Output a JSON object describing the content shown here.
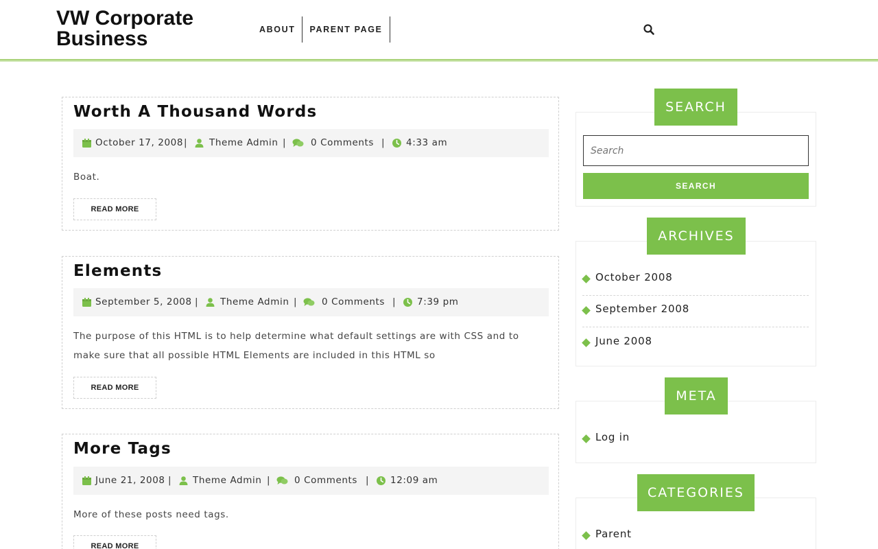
{
  "site": {
    "title": "VW Corporate Business"
  },
  "nav": {
    "items": [
      {
        "label": "ABOUT"
      },
      {
        "label": "PARENT PAGE"
      }
    ]
  },
  "icons": {
    "search": "search-icon",
    "calendar": "calendar-icon",
    "user": "user-icon",
    "comments": "comments-icon",
    "clock": "clock-icon",
    "bullet": "diamond-bullet-icon"
  },
  "colors": {
    "accent": "#7cc04b"
  },
  "posts": [
    {
      "title": "Worth A Thousand Words",
      "date": "October 17, 2008",
      "author": "Theme Admin",
      "comments": "0 Comments",
      "time": "4:33 am",
      "excerpt": "Boat.",
      "read_more": "READ MORE"
    },
    {
      "title": "Elements",
      "date": "September 5, 2008",
      "author": "Theme Admin",
      "comments": "0 Comments",
      "time": "7:39 pm",
      "excerpt": "The purpose of this HTML is to help determine what default settings are with CSS and to make sure that all possible HTML Elements are included in this HTML so",
      "read_more": "READ MORE"
    },
    {
      "title": "More Tags",
      "date": "June 21, 2008",
      "author": "Theme Admin",
      "comments": "0 Comments",
      "time": "12:09 am",
      "excerpt": "More of these posts need tags.",
      "read_more": "READ MORE"
    }
  ],
  "sidebar": {
    "search": {
      "title": "SEARCH",
      "placeholder": "Search",
      "button": "SEARCH"
    },
    "archives": {
      "title": "ARCHIVES",
      "items": [
        "October 2008",
        "September 2008",
        "June 2008"
      ]
    },
    "meta": {
      "title": "META",
      "items": [
        "Log in"
      ]
    },
    "categories": {
      "title": "CATEGORIES",
      "items": [
        "Parent"
      ]
    }
  }
}
